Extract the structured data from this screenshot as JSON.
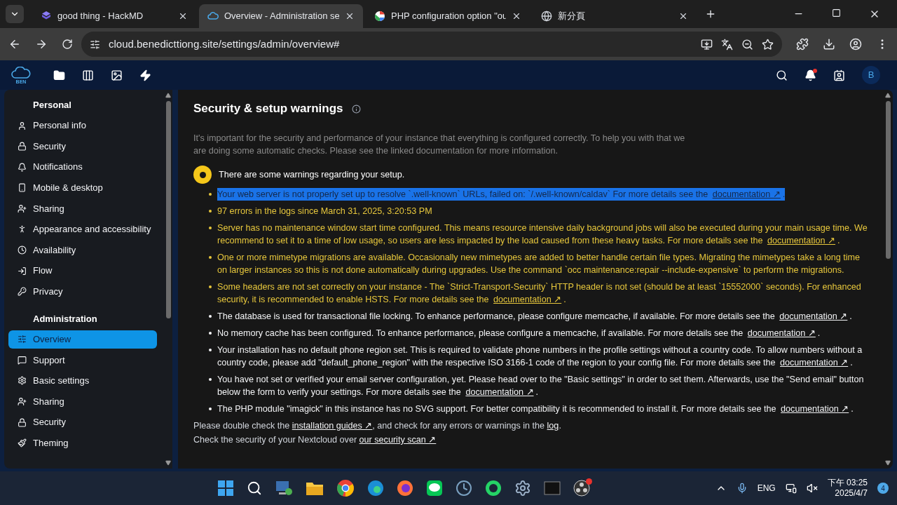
{
  "browser": {
    "tabs": [
      {
        "title": "good thing - HackMD",
        "selected": false
      },
      {
        "title": "Overview - Administration se",
        "selected": true
      },
      {
        "title": "PHP configuration option \"ou",
        "selected": false
      },
      {
        "title": "新分頁",
        "selected": false
      }
    ],
    "url": "cloud.benedicttiong.site/settings/admin/overview#"
  },
  "header": {
    "logo": "BEN",
    "avatar": "B",
    "notification_dot": true
  },
  "sidebar": {
    "sections": [
      {
        "title": "Personal",
        "items": [
          {
            "label": "Personal info",
            "selected": false
          },
          {
            "label": "Security",
            "selected": false
          },
          {
            "label": "Notifications",
            "selected": false
          },
          {
            "label": "Mobile & desktop",
            "selected": false
          },
          {
            "label": "Sharing",
            "selected": false
          },
          {
            "label": "Appearance and accessibility",
            "selected": false
          },
          {
            "label": "Availability",
            "selected": false
          },
          {
            "label": "Flow",
            "selected": false
          },
          {
            "label": "Privacy",
            "selected": false
          }
        ]
      },
      {
        "title": "Administration",
        "items": [
          {
            "label": "Overview",
            "selected": true
          },
          {
            "label": "Support",
            "selected": false
          },
          {
            "label": "Basic settings",
            "selected": false
          },
          {
            "label": "Sharing",
            "selected": false
          },
          {
            "label": "Security",
            "selected": false
          },
          {
            "label": "Theming",
            "selected": false
          }
        ]
      }
    ]
  },
  "content": {
    "title": "Security & setup warnings",
    "intro": "It's important for the security and performance of your instance that everything is configured correctly. To help you with that we are doing some automatic checks. Please see the linked documentation for more information.",
    "status": "There are some warnings regarding your setup.",
    "warnings": [
      {
        "is_warning": true,
        "highlighted": true,
        "text": "Your web server is not properly set up to resolve `.well-known` URLs, failed on: `/.well-known/caldav` For more details see the ",
        "link": "documentation ↗",
        "end": "."
      },
      {
        "is_warning": true,
        "highlighted": false,
        "text": "97 errors in the logs since March 31, 2025, 3:20:53 PM"
      },
      {
        "is_warning": true,
        "highlighted": false,
        "text": "Server has no maintenance window start time configured. This means resource intensive daily background jobs will also be executed during your main usage time. We recommend to set it to a time of low usage, so users are less impacted by the load caused from these heavy tasks. For more details see the ",
        "link": "documentation ↗",
        "end": "."
      },
      {
        "is_warning": true,
        "highlighted": false,
        "text": "One or more mimetype migrations are available. Occasionally new mimetypes are added to better handle certain file types. Migrating the mimetypes take a long time on larger instances so this is not done automatically during upgrades. Use the command `occ maintenance:repair --include-expensive` to perform the migrations."
      },
      {
        "is_warning": true,
        "highlighted": false,
        "text": "Some headers are not set correctly on your instance - The `Strict-Transport-Security` HTTP header is not set (should be at least `15552000` seconds). For enhanced security, it is recommended to enable HSTS. For more details see the ",
        "link": "documentation ↗",
        "end": "."
      },
      {
        "is_warning": false,
        "highlighted": false,
        "text": "The database is used for transactional file locking. To enhance performance, please configure memcache, if available. For more details see the ",
        "link": "documentation ↗",
        "end": "."
      },
      {
        "is_warning": false,
        "highlighted": false,
        "text": "No memory cache has been configured. To enhance performance, please configure a memcache, if available. For more details see the ",
        "link": "documentation ↗",
        "end": "."
      },
      {
        "is_warning": false,
        "highlighted": false,
        "text": "Your installation has no default phone region set. This is required to validate phone numbers in the profile settings without a country code. To allow numbers without a country code, please add \"default_phone_region\" with the respective ISO 3166-1 code of the region to your config file. For more details see the ",
        "link": "documentation ↗",
        "end": "."
      },
      {
        "is_warning": false,
        "highlighted": false,
        "text": "You have not set or verified your email server configuration, yet. Please head over to the \"Basic settings\" in order to set them. Afterwards, use the \"Send email\" button below the form to verify your settings. For more details see the ",
        "link": "documentation ↗",
        "end": "."
      },
      {
        "is_warning": false,
        "highlighted": false,
        "text": "The PHP module \"imagick\" in this instance has no SVG support. For better compatibility it is recommended to install it. For more details see the ",
        "link": "documentation ↗",
        "end": "."
      }
    ],
    "footer": [
      {
        "kind": "text",
        "text": "Please double check the "
      },
      {
        "kind": "link",
        "text": "installation guides ↗"
      },
      {
        "kind": "text",
        "text": ", and check for any errors or warnings in the "
      },
      {
        "kind": "link",
        "text": "log"
      },
      {
        "kind": "text",
        "text": "."
      }
    ],
    "footer2": [
      {
        "kind": "text",
        "text": "Check the security of your Nextcloud over "
      },
      {
        "kind": "link",
        "text": "our security scan ↗"
      }
    ]
  },
  "taskbar": {
    "language": "ENG",
    "time": "下午 03:25",
    "date": "2025/4/7",
    "badge": "4"
  }
}
